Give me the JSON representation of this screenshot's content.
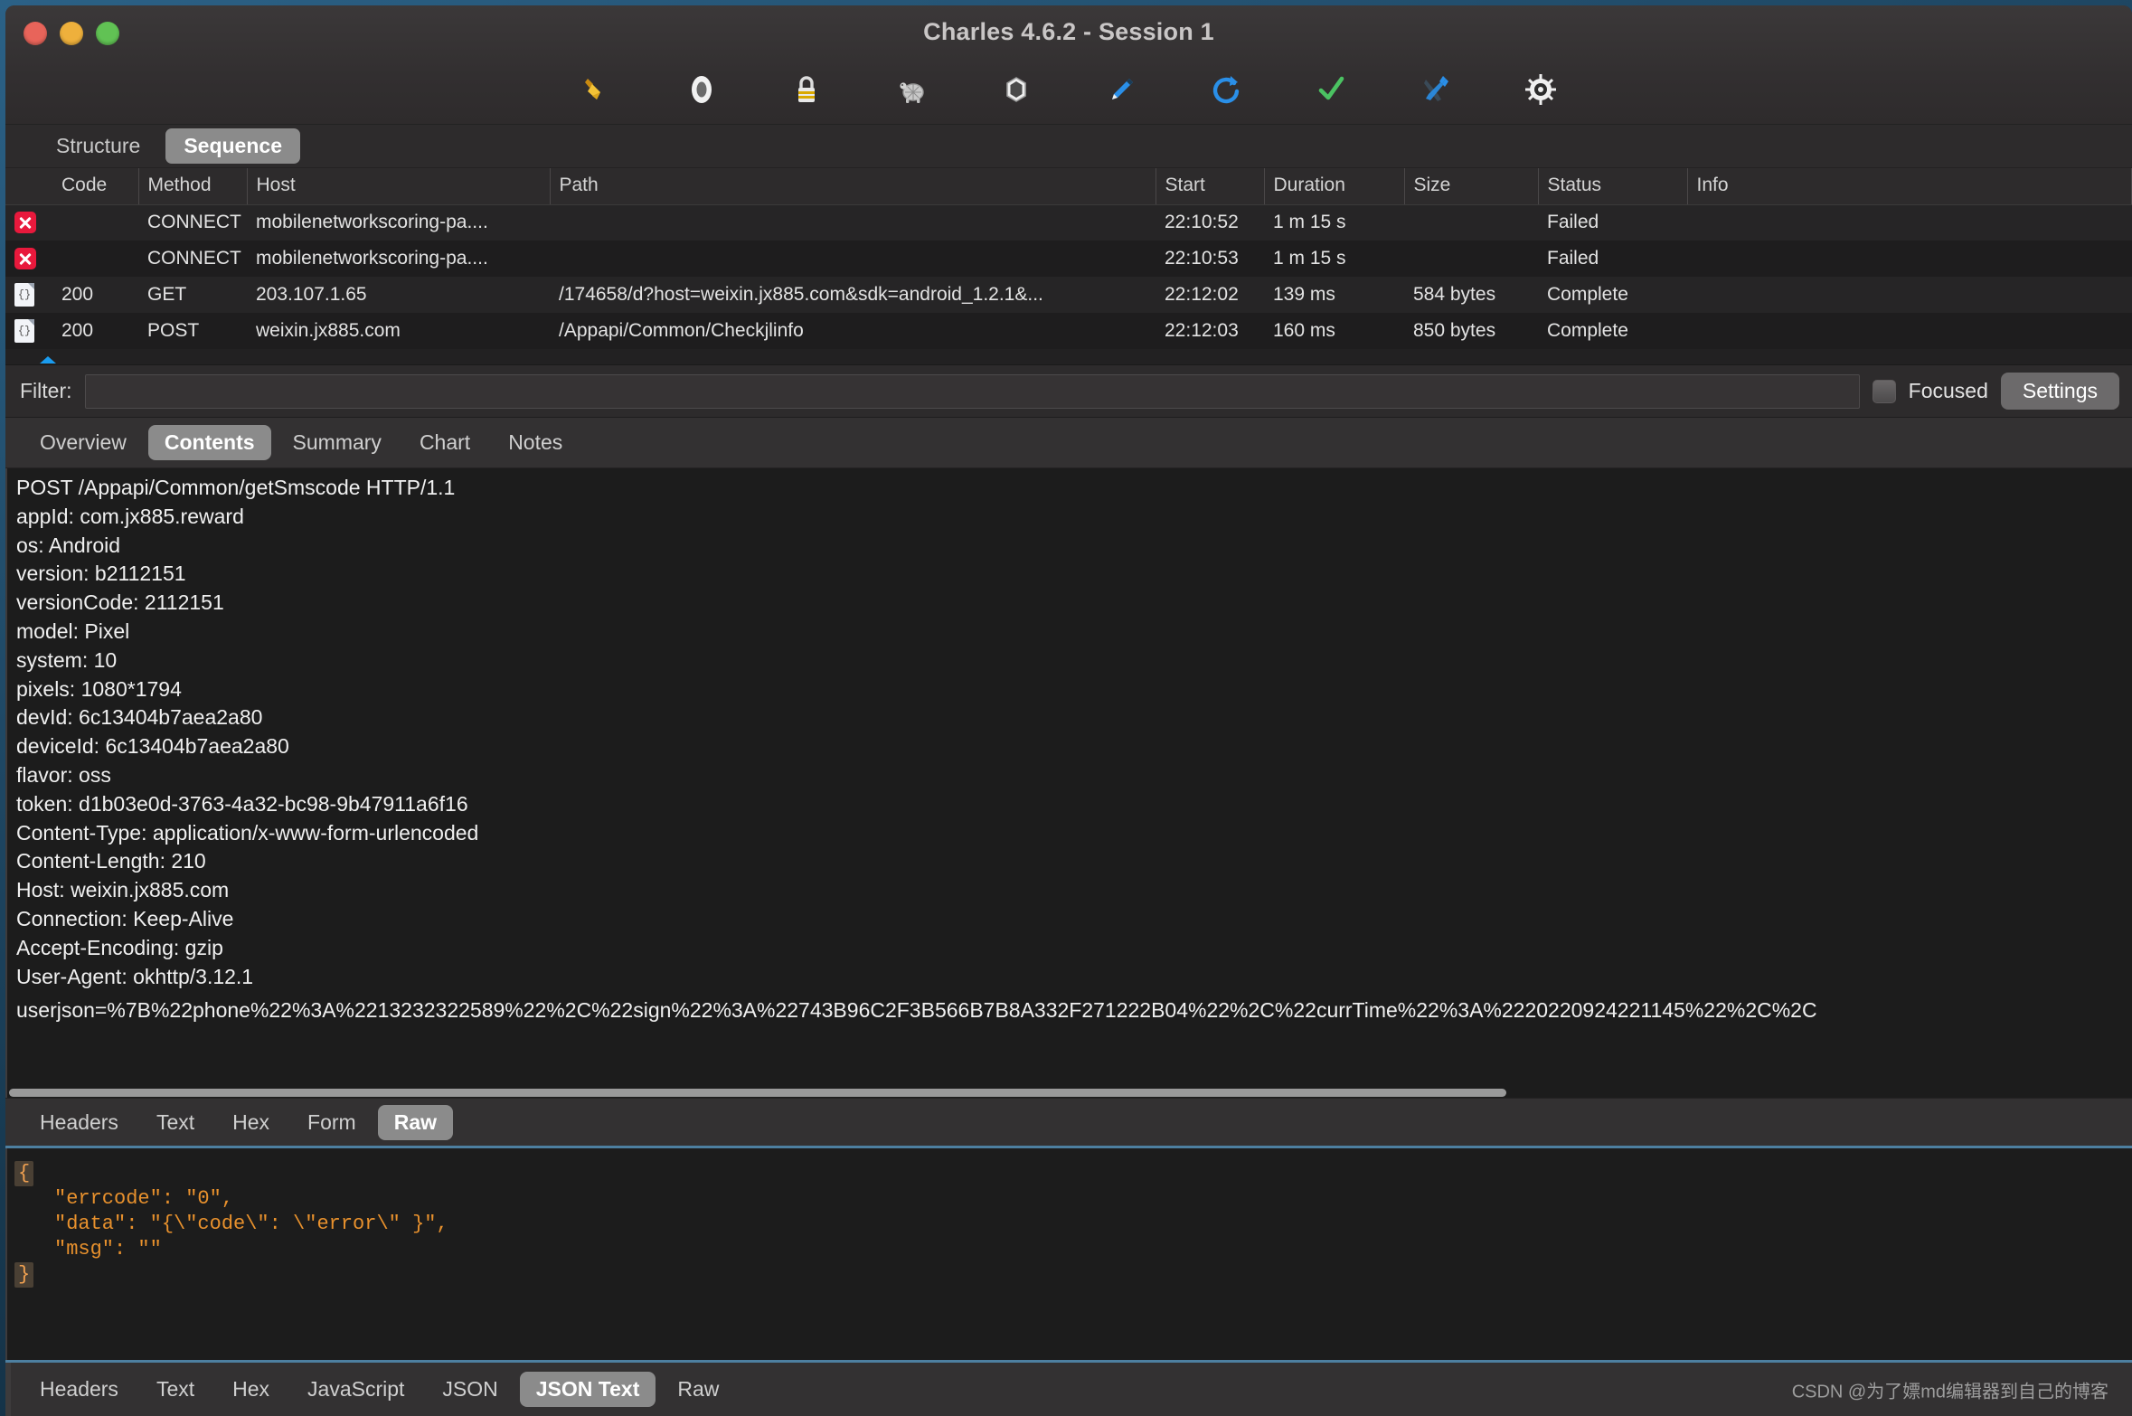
{
  "window": {
    "title": "Charles 4.6.2 - Session 1",
    "traffic_lights": [
      "close",
      "minimize",
      "zoom"
    ]
  },
  "toolbar": {
    "items": [
      {
        "name": "clear-broom-icon",
        "label": "Clear"
      },
      {
        "name": "record-icon",
        "label": "Start/Stop Recording"
      },
      {
        "name": "ssl-lock-icon",
        "label": "SSL Proxying"
      },
      {
        "name": "throttle-turtle-icon",
        "label": "Throttling"
      },
      {
        "name": "breakpoints-icon",
        "label": "Breakpoints"
      },
      {
        "name": "compose-pen-icon",
        "label": "Compose"
      },
      {
        "name": "repeat-refresh-icon",
        "label": "Repeat"
      },
      {
        "name": "validate-check-icon",
        "label": "Validate"
      },
      {
        "name": "tools-icon",
        "label": "Tools"
      },
      {
        "name": "gear-icon",
        "label": "Settings"
      }
    ]
  },
  "view_toggle": {
    "structure_label": "Structure",
    "sequence_label": "Sequence",
    "active": "Sequence"
  },
  "requests_table": {
    "columns": [
      "",
      "Code",
      "Method",
      "Host",
      "Path",
      "Start",
      "Duration",
      "Size",
      "Status",
      "Info"
    ],
    "rows": [
      {
        "icon": "failed-x-icon",
        "code": "",
        "method": "CONNECT",
        "host": "mobilenetworkscoring-pa....",
        "path": "",
        "start": "22:10:52",
        "duration": "1 m 15 s",
        "size": "",
        "status": "Failed",
        "info": ""
      },
      {
        "icon": "failed-x-icon",
        "code": "",
        "method": "CONNECT",
        "host": "mobilenetworkscoring-pa....",
        "path": "",
        "start": "22:10:53",
        "duration": "1 m 15 s",
        "size": "",
        "status": "Failed",
        "info": ""
      },
      {
        "icon": "json-doc-icon",
        "code": "200",
        "method": "GET",
        "host": "203.107.1.65",
        "path": "/174658/d?host=weixin.jx885.com&sdk=android_1.2.1&...",
        "start": "22:12:02",
        "duration": "139 ms",
        "size": "584 bytes",
        "status": "Complete",
        "info": ""
      },
      {
        "icon": "json-doc-icon",
        "code": "200",
        "method": "POST",
        "host": "weixin.jx885.com",
        "path": "/Appapi/Common/Checkjlinfo",
        "start": "22:12:03",
        "duration": "160 ms",
        "size": "850 bytes",
        "status": "Complete",
        "info": ""
      }
    ]
  },
  "filter": {
    "label": "Filter:",
    "value": "",
    "placeholder": "",
    "focused_label": "Focused",
    "focused_checked": false,
    "settings_label": "Settings"
  },
  "request_pane": {
    "tabs": [
      {
        "label": "Overview",
        "active": false
      },
      {
        "label": "Contents",
        "active": true
      },
      {
        "label": "Summary",
        "active": false
      },
      {
        "label": "Chart",
        "active": false
      },
      {
        "label": "Notes",
        "active": false
      }
    ],
    "body_lines": [
      "POST /Appapi/Common/getSmscode HTTP/1.1",
      "appId: com.jx885.reward",
      "os: Android",
      "version: b2112151",
      "versionCode: 2112151",
      "model: Pixel",
      "system: 10",
      "pixels: 1080*1794",
      "devId: 6c13404b7aea2a80",
      "deviceId: 6c13404b7aea2a80",
      "flavor: oss",
      "token: d1b03e0d-3763-4a32-bc98-9b47911a6f16",
      "Content-Type: application/x-www-form-urlencoded",
      "Content-Length: 210",
      "Host: weixin.jx885.com",
      "Connection: Keep-Alive",
      "Accept-Encoding: gzip",
      "User-Agent: okhttp/3.12.1"
    ],
    "body_payload": "userjson=%7B%22phone%22%3A%2213232322589%22%2C%22sign%22%3A%22743B96C2F3B566B7B8A332F271222B04%22%2C%22currTime%22%3A%2220220924221145%22%2C%2C",
    "bottom_tabs": [
      {
        "label": "Headers",
        "active": false
      },
      {
        "label": "Text",
        "active": false
      },
      {
        "label": "Hex",
        "active": false
      },
      {
        "label": "Form",
        "active": false
      },
      {
        "label": "Raw",
        "active": true
      }
    ]
  },
  "response_pane": {
    "json_lines": [
      {
        "indent": 0,
        "brace": "{",
        "text": ""
      },
      {
        "indent": 1,
        "brace": "",
        "text": "\"errcode\": \"0\","
      },
      {
        "indent": 1,
        "brace": "",
        "text": "\"data\": \"{\\\"code\\\": \\\"error\\\" }\","
      },
      {
        "indent": 1,
        "brace": "",
        "text": "\"msg\": \"\""
      },
      {
        "indent": 0,
        "brace": "}",
        "text": ""
      }
    ],
    "bottom_tabs": [
      {
        "label": "Headers",
        "active": false
      },
      {
        "label": "Text",
        "active": false
      },
      {
        "label": "Hex",
        "active": false
      },
      {
        "label": "JavaScript",
        "active": false
      },
      {
        "label": "JSON",
        "active": false
      },
      {
        "label": "JSON Text",
        "active": true
      },
      {
        "label": "Raw",
        "active": false
      }
    ],
    "watermark": "CSDN @为了嫖md编辑器到自己的博客"
  },
  "colors": {
    "accent_blue": "#4d7fa0",
    "json_orange": "#e8912d",
    "error_red": "#e8193c",
    "marker_blue": "#1a9cf0",
    "window_bg": "#2b2b2b"
  }
}
